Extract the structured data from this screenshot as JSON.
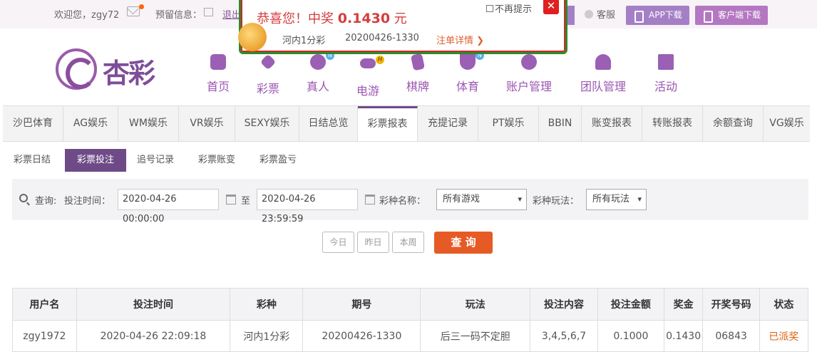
{
  "topbar": {
    "welcome": "欢迎您，zgy72",
    "notice_label": "预留信息：",
    "logout": "退出",
    "service": "客服",
    "app_download": "APP下载",
    "client_download": "客户端下载"
  },
  "logo": {
    "text": "杏彩"
  },
  "nav": [
    {
      "label": "首页",
      "icon": "home-icon",
      "badge": ""
    },
    {
      "label": "彩票",
      "icon": "lottery-ticket-icon",
      "badge": ""
    },
    {
      "label": "真人",
      "icon": "live-dealer-icon",
      "badge": "N"
    },
    {
      "label": "电游",
      "icon": "gamepad-icon",
      "badge": "H"
    },
    {
      "label": "棋牌",
      "icon": "cards-icon",
      "badge": ""
    },
    {
      "label": "体育",
      "icon": "trophy-icon",
      "badge": "N"
    },
    {
      "label": "账户管理",
      "icon": "account-icon",
      "badge": ""
    },
    {
      "label": "团队管理",
      "icon": "team-icon",
      "badge": ""
    },
    {
      "label": "活动",
      "icon": "gift-icon",
      "badge": ""
    }
  ],
  "popup": {
    "title_prefix": "恭喜您！中奖 ",
    "amount": "0.1430",
    "title_suffix": " 元",
    "game": "河内1分彩",
    "period": "20200426-1330",
    "detail_link": "注单详情 ❯",
    "no_remind": "不再提示",
    "close": "✕"
  },
  "tabs": [
    "沙巴体育",
    "AG娱乐",
    "WM娱乐",
    "VR娱乐",
    "SEXY娱乐",
    "日结总览",
    "彩票报表",
    "充提记录",
    "PT娱乐",
    "BBIN",
    "账变报表",
    "转账报表",
    "余额查询",
    "VG娱乐"
  ],
  "active_tab": "彩票报表",
  "subtabs": [
    "彩票日结",
    "彩票投注",
    "追号记录",
    "彩票账变",
    "彩票盈亏"
  ],
  "active_subtab": "彩票投注",
  "filter": {
    "query_label": "查询:",
    "time_label": "投注时间：",
    "start_time": "2020-04-26 00:00:00",
    "to": "至",
    "end_time": "2020-04-26 23:59:59",
    "game_label": "彩种名称：",
    "game_value": "所有游戏",
    "play_label": "彩种玩法：",
    "play_value": "所有玩法"
  },
  "quick": {
    "today": "今日",
    "yesterday": "昨日",
    "week": "本周",
    "search": "查 询"
  },
  "table": {
    "headers": [
      "用户名",
      "投注时间",
      "彩种",
      "期号",
      "玩法",
      "投注内容",
      "投注金额",
      "奖金",
      "开奖号码",
      "状态"
    ],
    "rows": [
      [
        "zgy1972",
        "2020-04-26 22:09:18",
        "河内1分彩",
        "20200426-1330",
        "后三一码不定胆",
        "3,4,5,6,7",
        "0.1000",
        "0.1430",
        "06843",
        "已派奖"
      ]
    ]
  },
  "colors": {
    "accent": "#6e4a86",
    "brand_purple": "#9b56b2",
    "search_button": "#e65b25",
    "status_paid": "#e06010",
    "popup_red": "#d53d3d"
  }
}
